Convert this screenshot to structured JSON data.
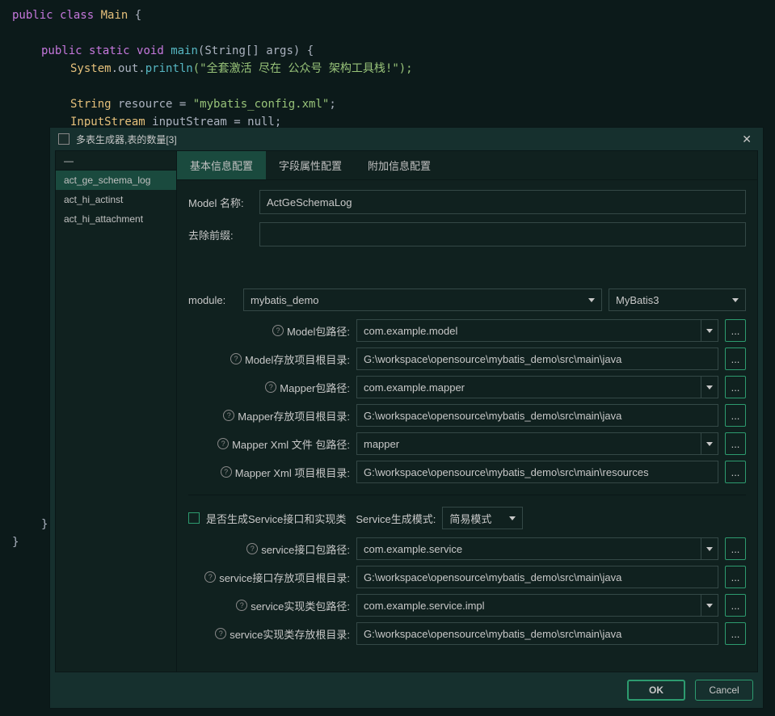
{
  "code": {
    "line1_public": "public",
    "line1_class": "class",
    "line1_Main": "Main",
    "line1_brace": " {",
    "line2_public": "public",
    "line2_static": "static",
    "line2_void": "void",
    "line2_main": "main",
    "line2_params": "(String[] args)",
    "line2_brace": " {",
    "line3_system": "System",
    "line3_out": ".out.",
    "line3_println": "println",
    "line3_args": "(\"全套激活 尽在 公众号 架构工具栈!\");",
    "line4_string": "String",
    "line4_resource": " resource = ",
    "line4_value": "\"mybatis_config.xml\"",
    "line4_semi": ";",
    "line5_inputstream": "InputStream",
    "line5_rest": " inputStream = null;",
    "brace_close_inner": "}",
    "brace_close_outer": "}"
  },
  "dialog": {
    "title": "多表生成器,表的数量[3]",
    "close": "✕"
  },
  "sidebar": {
    "header": "—",
    "items": [
      {
        "label": "act_ge_schema_log"
      },
      {
        "label": "act_hi_actinst"
      },
      {
        "label": "act_hi_attachment"
      }
    ]
  },
  "tabs": {
    "t1": "基本信息配置",
    "t2": "字段属性配置",
    "t3": "附加信息配置"
  },
  "fields": {
    "model_name_label": "Model 名称:",
    "model_name_value": "ActGeSchemaLog",
    "remove_prefix_label": "去除前缀:",
    "remove_prefix_value": "",
    "module_label": "module:",
    "module_value": "mybatis_demo",
    "mybatis_value": "MyBatis3",
    "model_pkg_label": "Model包路径:",
    "model_pkg_value": "com.example.model",
    "model_root_label": "Model存放项目根目录:",
    "model_root_value": "G:\\workspace\\opensource\\mybatis_demo\\src\\main\\java",
    "mapper_pkg_label": "Mapper包路径:",
    "mapper_pkg_value": "com.example.mapper",
    "mapper_root_label": "Mapper存放项目根目录:",
    "mapper_root_value": "G:\\workspace\\opensource\\mybatis_demo\\src\\main\\java",
    "mapper_xml_pkg_label": "Mapper Xml 文件 包路径:",
    "mapper_xml_pkg_value": "mapper",
    "mapper_xml_root_label": "Mapper Xml 项目根目录:",
    "mapper_xml_root_value": "G:\\workspace\\opensource\\mybatis_demo\\src\\main\\resources",
    "gen_service_label": "是否生成Service接口和实现类",
    "service_mode_label": "Service生成模式:",
    "service_mode_value": "简易模式",
    "service_pkg_label": "service接口包路径:",
    "service_pkg_value": "com.example.service",
    "service_root_label": "service接口存放项目根目录:",
    "service_root_value": "G:\\workspace\\opensource\\mybatis_demo\\src\\main\\java",
    "service_impl_pkg_label": "service实现类包路径:",
    "service_impl_pkg_value": "com.example.service.impl",
    "service_impl_root_label": "service实现类存放根目录:",
    "service_impl_root_value": "G:\\workspace\\opensource\\mybatis_demo\\src\\main\\java"
  },
  "buttons": {
    "ok": "OK",
    "cancel": "Cancel",
    "browse": "...",
    "help": "?"
  }
}
